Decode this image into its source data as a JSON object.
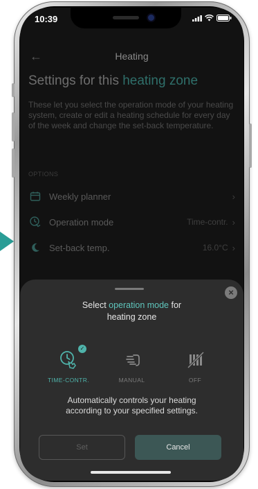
{
  "status_bar": {
    "time": "10:39"
  },
  "header": {
    "title": "Heating"
  },
  "main": {
    "title_prefix": "Settings for this ",
    "title_accent": "heating zone",
    "description": "These let you select the operation mode of your heating system, create or edit a heating schedule for every day of the week and change the set-back temperature.",
    "options_label": "OPTIONS",
    "options": [
      {
        "label": "Weekly planner",
        "value": "",
        "icon": "calendar-icon"
      },
      {
        "label": "Operation mode",
        "value": "Time-contr.",
        "icon": "clock-hand-icon"
      },
      {
        "label": "Set-back temp.",
        "value": "16.0°C",
        "icon": "moon-icon"
      }
    ]
  },
  "sheet": {
    "title_prefix": "Select ",
    "title_accent": "operation mode",
    "title_suffix": " for",
    "title_line2": "heating zone",
    "modes": [
      {
        "label": "TIME-CONTR.",
        "selected": true,
        "icon": "clock-hand-icon"
      },
      {
        "label": "MANUAL",
        "selected": false,
        "icon": "hand-tap-icon"
      },
      {
        "label": "OFF",
        "selected": false,
        "icon": "radiator-off-icon"
      }
    ],
    "mode_description_line1": "Automatically controls your heating",
    "mode_description_line2": "according to your specified settings.",
    "set_label": "Set",
    "cancel_label": "Cancel"
  },
  "colors": {
    "accent": "#4fb3aa",
    "cancel_button": "#3c5755",
    "sheet": "#2d2d2d",
    "pointer": "#2a9d96"
  }
}
